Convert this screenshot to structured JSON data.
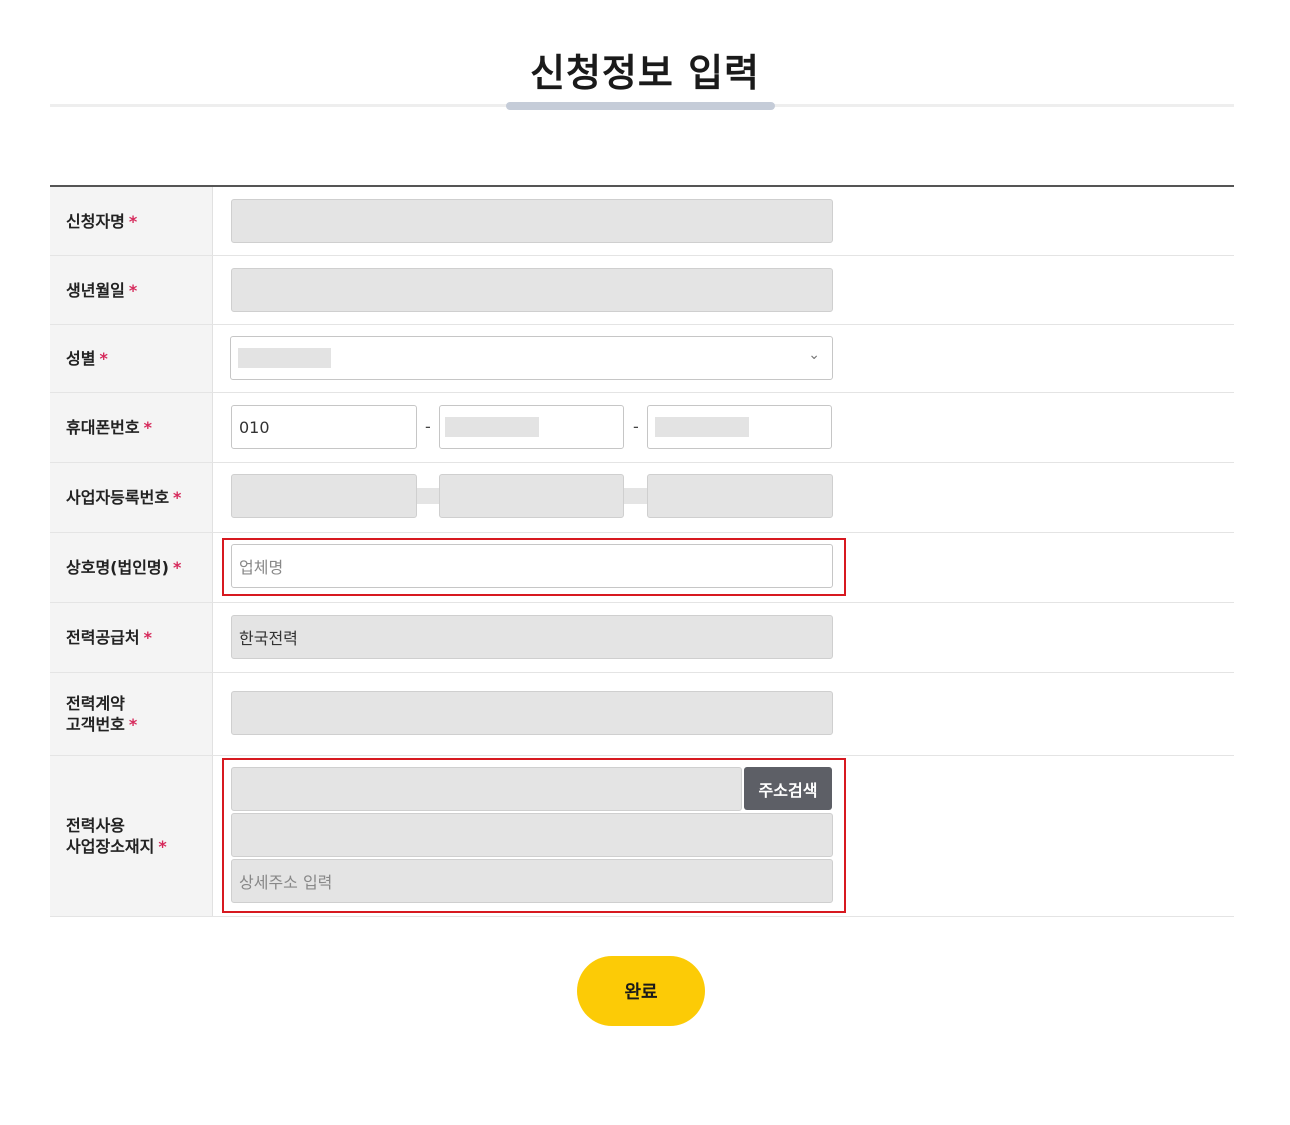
{
  "page": {
    "title": "신청정보 입력"
  },
  "colors": {
    "required_star": "#d6295b",
    "highlight_border": "#d71920",
    "primary_button": "#fccb06",
    "address_button": "#5d5f66"
  },
  "form": {
    "required_mark": "*",
    "rows": [
      {
        "label": "신청자명",
        "value": ""
      },
      {
        "label": "생년월일",
        "value": ""
      },
      {
        "label": "성별",
        "value": ""
      },
      {
        "label": "휴대폰번호",
        "prefix": "010",
        "separator": "-"
      },
      {
        "label": "사업자등록번호"
      },
      {
        "label": "상호명(법인명)",
        "placeholder": "업체명"
      },
      {
        "label": "전력공급처",
        "value": "한국전력"
      },
      {
        "label_line1": "전력계약",
        "label_line2": "고객번호",
        "value": ""
      },
      {
        "label_line1": "전력사용",
        "label_line2": "사업장소재지",
        "detail_placeholder": "상세주소 입력"
      }
    ]
  },
  "buttons": {
    "address_search": "주소검색",
    "submit": "완료"
  }
}
